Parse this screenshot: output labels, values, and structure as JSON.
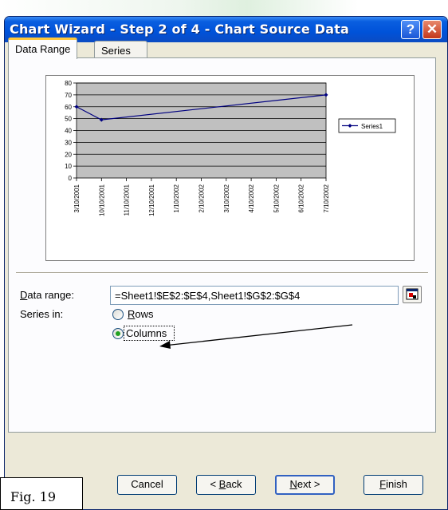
{
  "window": {
    "title": "Chart Wizard - Step 2 of 4 - Chart Source Data",
    "help_glyph": "?",
    "close_glyph": "✕"
  },
  "tabs": [
    {
      "label": "Data Range",
      "active": true
    },
    {
      "label": "Series",
      "active": false
    }
  ],
  "chart_data": {
    "type": "line",
    "categories": [
      "3/10/2001",
      "10/10/2001",
      "11/10/2001",
      "12/10/2001",
      "1/10/2002",
      "2/10/2002",
      "3/10/2002",
      "4/10/2002",
      "5/10/2002",
      "6/10/2002",
      "7/10/2002"
    ],
    "x": [
      "3/10/2001",
      "10/10/2001",
      "7/10/2002"
    ],
    "series": [
      {
        "name": "Series1",
        "values": [
          60,
          49,
          70
        ],
        "color": "#000080"
      }
    ],
    "ylim": [
      0,
      80
    ],
    "yticks": [
      "0",
      "10",
      "20",
      "30",
      "40",
      "50",
      "60",
      "70",
      "80"
    ],
    "grid": true,
    "plot_background": "#c0c0c0",
    "legend": "right"
  },
  "form": {
    "data_range_label_u": "D",
    "data_range_label_rest": "ata range:",
    "data_range_value": "=Sheet1!$E$2:$E$4,Sheet1!$G$2:$G$4",
    "series_in_label": "Series in:",
    "rows_label_u": "R",
    "rows_label_rest": "ows",
    "columns_label": "Columns",
    "selected": "Columns",
    "radio_selected_color": "#21a121"
  },
  "buttons": {
    "cancel": "Cancel",
    "back_pre": "< ",
    "back_u": "B",
    "back_rest": "ack",
    "next_u": "N",
    "next_rest": "ext >",
    "finish_u": "F",
    "finish_rest": "inish"
  },
  "figure_label": "Fig. 19"
}
